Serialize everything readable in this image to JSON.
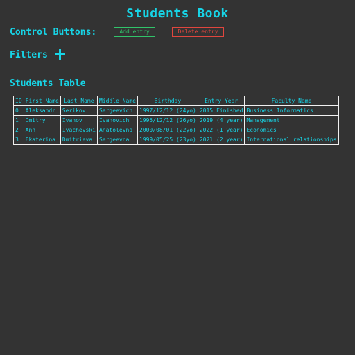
{
  "header": {
    "title": "Students Book"
  },
  "controls": {
    "label": "Control Buttons:",
    "add_label": "Add entry",
    "delete_label": "Delete entry"
  },
  "filters": {
    "label": "Filters"
  },
  "table_section": {
    "label": "Students Table"
  },
  "table": {
    "columns": [
      "ID",
      "First Name",
      "Last Name",
      "Middle Name",
      "Birthday",
      "Entry Year",
      "Faculty Name"
    ],
    "rows": [
      [
        "0",
        "Aleksandr",
        "Serikov",
        "Sergeevich",
        "1997/12/12 (24yo)",
        "2015 Finished",
        "Business Informatics"
      ],
      [
        "1",
        "Dmitry",
        "Ivanov",
        "Ivanovich",
        "1995/12/12 (26yo)",
        "2019 (4 year)",
        "Management"
      ],
      [
        "2",
        "Ann",
        "Ivachevski",
        "Anatolevna",
        "2000/08/01 (22yo)",
        "2022 (1 year)",
        "Economics"
      ],
      [
        "3",
        "Ekaterina",
        "Dmitrieva",
        "Sergeevna",
        "1999/05/25 (23yo)",
        "2021 (2 year)",
        "International relationships"
      ]
    ]
  },
  "colors": {
    "background": "#333333",
    "accent": "#17d4e6",
    "add": "#31c46a",
    "delete": "#e0463e"
  }
}
